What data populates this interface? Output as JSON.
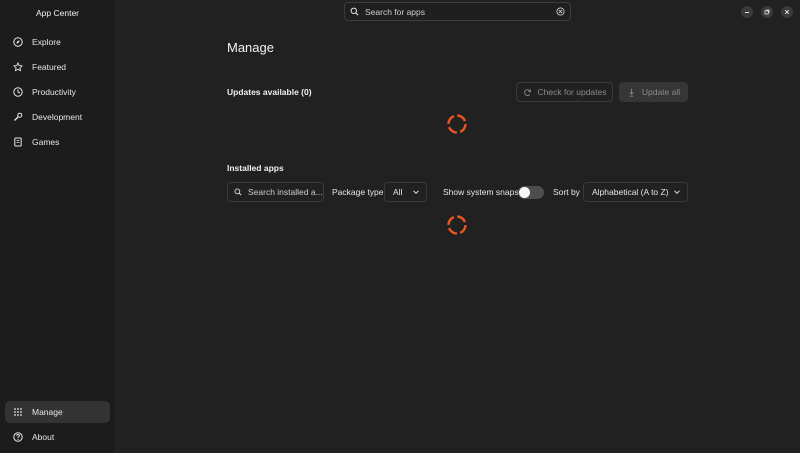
{
  "app_title": "App Center",
  "sidebar": {
    "items": [
      {
        "label": "Explore",
        "icon": "compass-icon"
      },
      {
        "label": "Featured",
        "icon": "star-icon"
      },
      {
        "label": "Productivity",
        "icon": "clock-icon"
      },
      {
        "label": "Development",
        "icon": "wrench-icon"
      },
      {
        "label": "Games",
        "icon": "gamepad-icon"
      }
    ],
    "bottom_items": [
      {
        "label": "Manage",
        "icon": "grid-icon",
        "active": true
      },
      {
        "label": "About",
        "icon": "help-icon"
      }
    ]
  },
  "search": {
    "placeholder": "Search for apps"
  },
  "window_controls": [
    "minimize-icon",
    "restore-icon",
    "close-icon"
  ],
  "page_title": "Manage",
  "updates": {
    "title": "Updates available (0)",
    "check_label": "Check for updates",
    "update_all_label": "Update all"
  },
  "installed": {
    "title": "Installed apps",
    "search_placeholder": "Search installed a...",
    "package_type_label": "Package type",
    "package_type_value": "All",
    "show_system_snaps_label": "Show system snaps",
    "show_system_snaps_on": false,
    "sort_label": "Sort by",
    "sort_value": "Alphabetical (A to Z)"
  },
  "colors": {
    "accent": "#e95420",
    "background": "#212121",
    "sidebar": "#1c1c1c"
  }
}
